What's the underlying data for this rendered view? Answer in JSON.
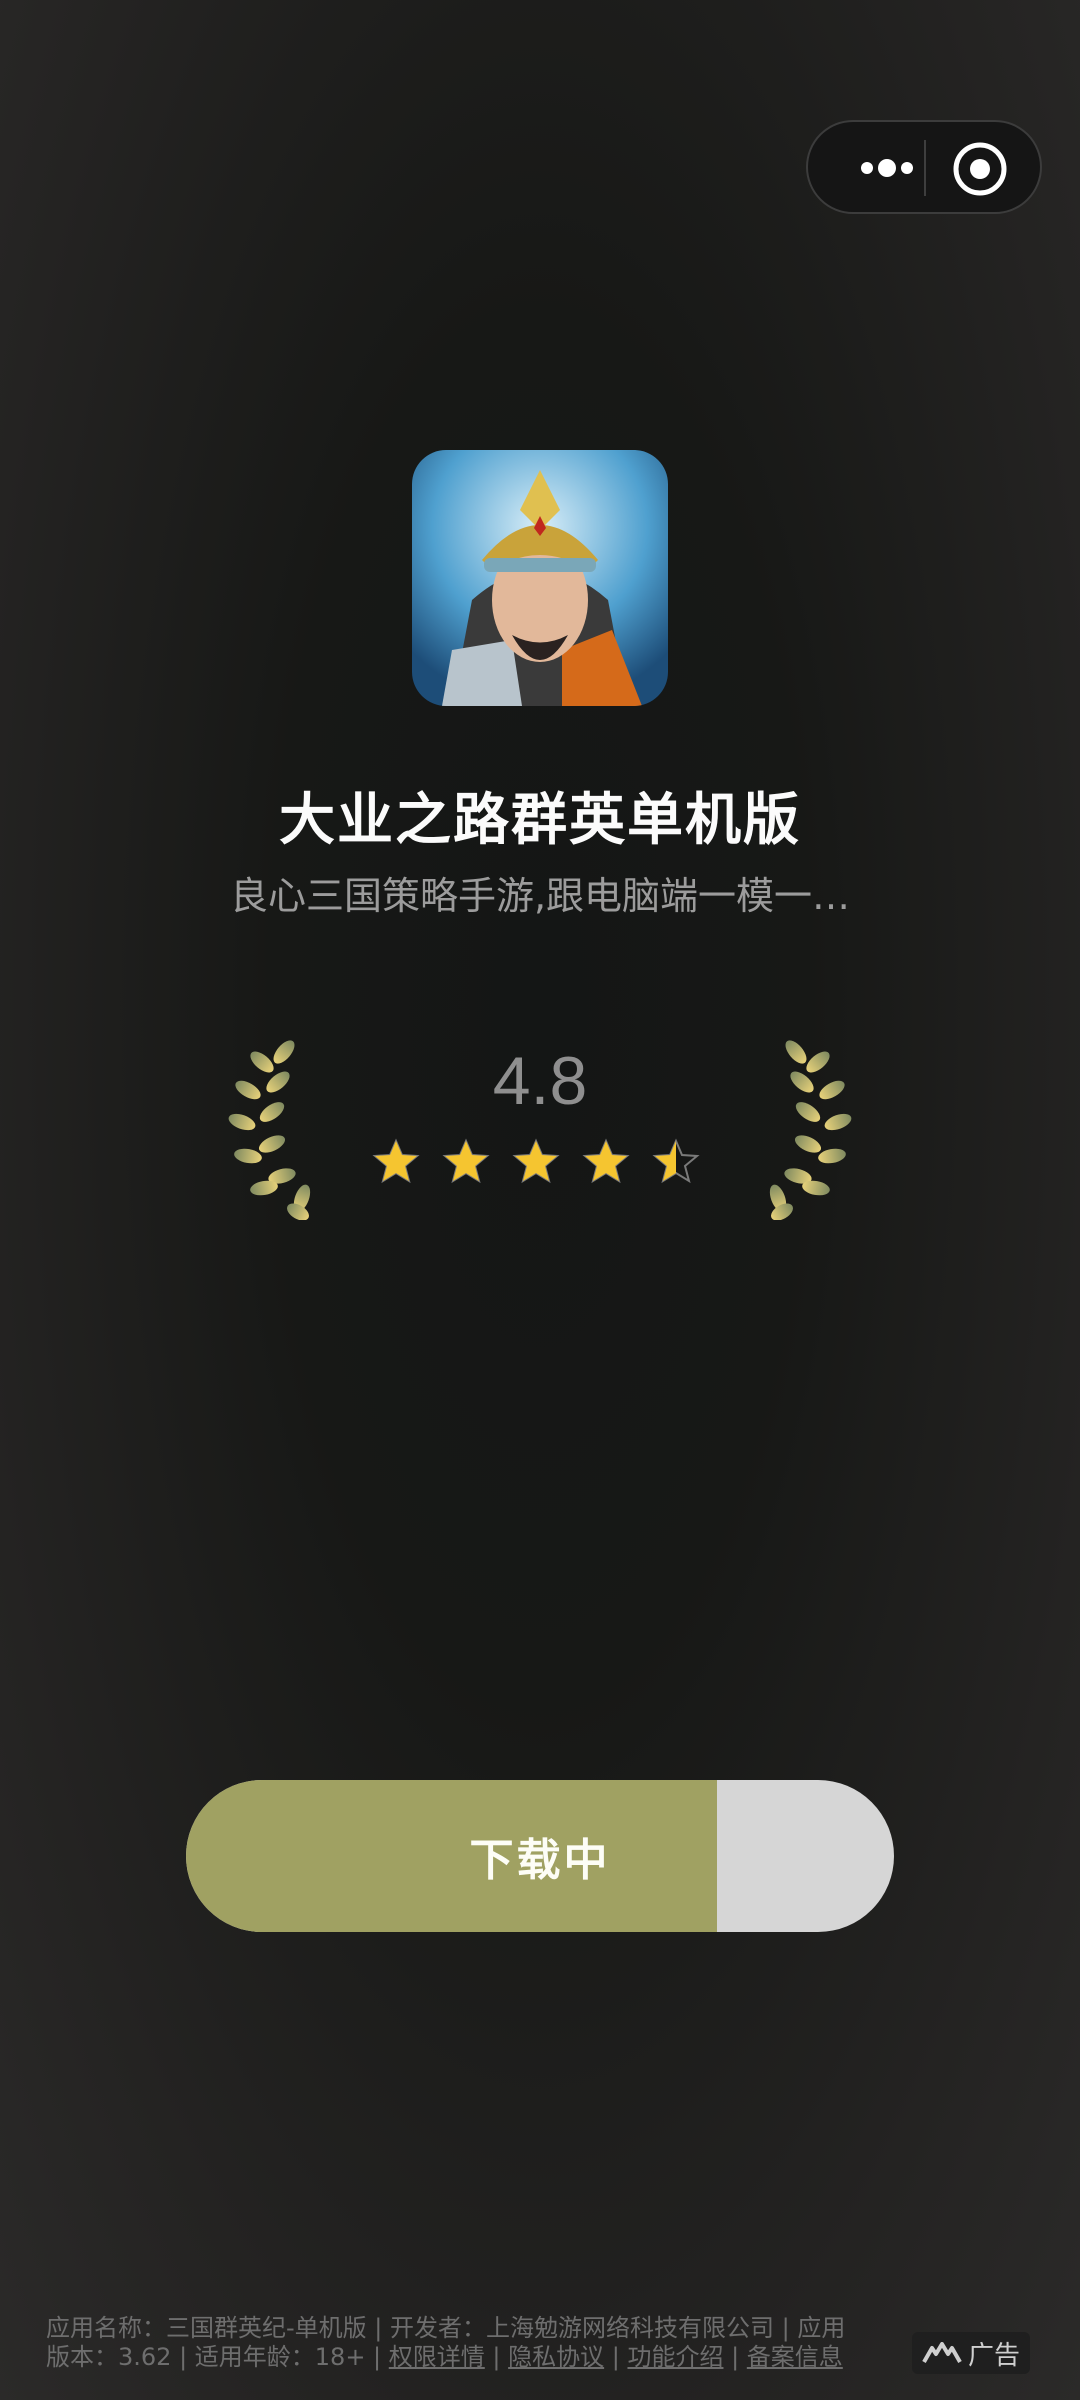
{
  "capsule": {
    "more_icon": "more-dots-icon",
    "close_icon": "close-target-icon"
  },
  "app": {
    "name": "大业之路群英单机版",
    "tagline": "良心三国策略手游,跟电脑端一模一…",
    "rating": "4.8",
    "rating_value": 4.5,
    "stars_total": 5
  },
  "download": {
    "label": "下载中",
    "progress": 0.75,
    "fill_color": "#a0a162"
  },
  "footer": {
    "line1": "应用名称：三国群英纪-单机版 | 开发者：上海勉游网络科技有限公司 | 应用",
    "version_prefix": "版本：3.62 | 适用年龄：18+ | ",
    "permissions": "权限详情",
    "sep": " | ",
    "privacy": "隐私协议",
    "features": "功能介绍",
    "filing": "备案信息"
  },
  "ad_badge": {
    "label": "广告",
    "icon": "ad-logo-icon"
  }
}
